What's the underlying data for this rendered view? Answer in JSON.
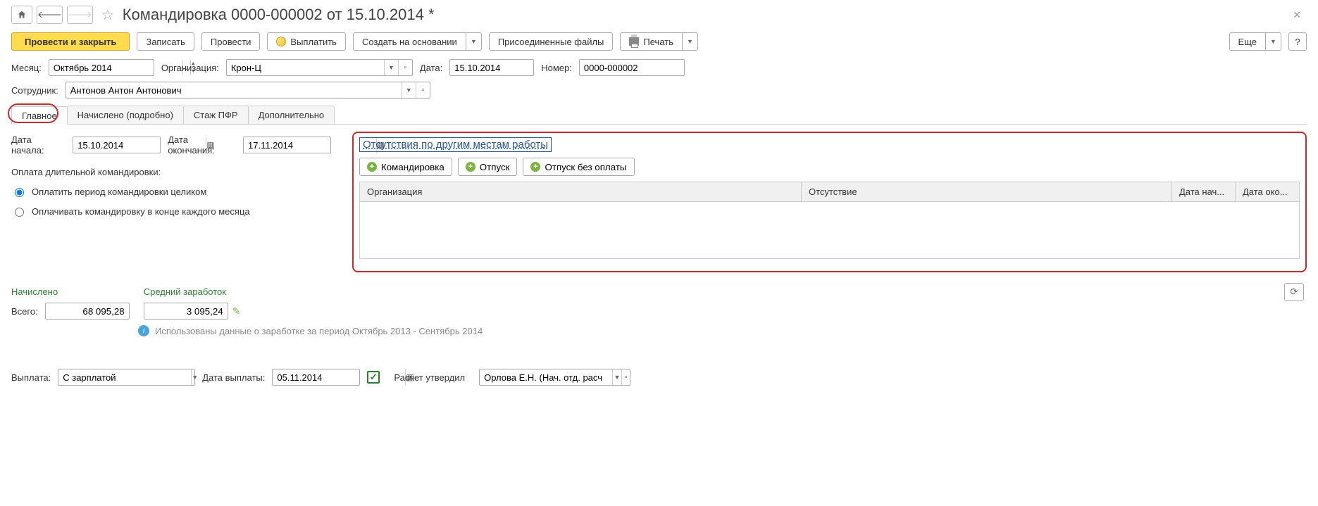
{
  "header": {
    "title": "Командировка 0000-000002 от 15.10.2014 *"
  },
  "toolbar": {
    "post_close": "Провести и закрыть",
    "save": "Записать",
    "post": "Провести",
    "pay": "Выплатить",
    "create_on": "Создать на основании",
    "attached": "Присоединенные файлы",
    "print": "Печать",
    "more": "Еще",
    "help": "?"
  },
  "form": {
    "month_label": "Месяц:",
    "month_value": "Октябрь 2014",
    "org_label": "Организация:",
    "org_value": "Крон-Ц",
    "date_label": "Дата:",
    "date_value": "15.10.2014",
    "number_label": "Номер:",
    "number_value": "0000-000002",
    "employee_label": "Сотрудник:",
    "employee_value": "Антонов Антон Антонович"
  },
  "tabs": {
    "main": "Главное",
    "accrued": "Начислено (подробно)",
    "pfr": "Стаж ПФР",
    "extra": "Дополнительно"
  },
  "main_tab": {
    "start_date_label": "Дата начала:",
    "start_date": "15.10.2014",
    "end_date_label": "Дата окончания:",
    "end_date": "17.11.2014",
    "long_trip_label": "Оплата длительной командировки:",
    "radio_full": "Оплатить период командировки целиком",
    "radio_monthly": "Оплачивать командировку в конце каждого месяца"
  },
  "absence": {
    "title": "Отсутствия по другим местам работы",
    "btn_trip": "Командировка",
    "btn_leave": "Отпуск",
    "btn_unpaid": "Отпуск без оплаты",
    "col_org": "Организация",
    "col_abs": "Отсутствие",
    "col_start": "Дата нач...",
    "col_end": "Дата око..."
  },
  "totals": {
    "accrued": "Начислено",
    "avg": "Средний заработок",
    "total_label": "Всего:",
    "total_value": "68 095,28",
    "avg_value": "3 095,24",
    "info": "Использованы данные о заработке за период Октябрь 2013 - Сентябрь 2014"
  },
  "footer": {
    "payout_label": "Выплата:",
    "payout_value": "С зарплатой",
    "paydate_label": "Дата выплаты:",
    "paydate_value": "05.11.2014",
    "approved_label": "Расчет утвердил",
    "approved_value": "Орлова Е.Н. (Нач. отд. расч"
  }
}
